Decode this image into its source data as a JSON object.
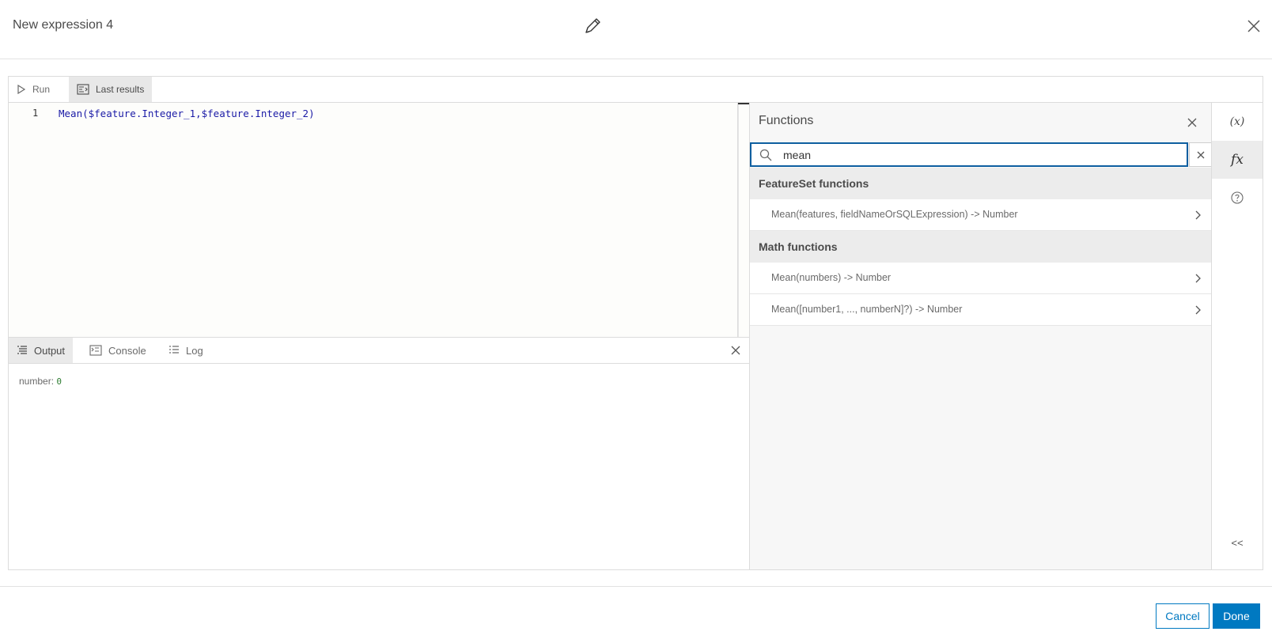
{
  "header": {
    "title": "New expression 4",
    "edit_icon": "pencil-icon",
    "close_icon": "close-icon"
  },
  "toolbar": {
    "run_label": "Run",
    "last_results_label": "Last results"
  },
  "editor": {
    "line_number": "1",
    "code": "Mean($feature.Integer_1,$feature.Integer_2)"
  },
  "output_tabs": {
    "output_label": "Output",
    "console_label": "Console",
    "log_label": "Log"
  },
  "output": {
    "key": "number:",
    "value": "0"
  },
  "functions_panel": {
    "title": "Functions",
    "search_value": "mean",
    "groups": [
      {
        "name": "FeatureSet functions",
        "items": [
          "Mean(features, fieldNameOrSQLExpression) -> Number"
        ]
      },
      {
        "name": "Math functions",
        "items": [
          "Mean(numbers) -> Number",
          "Mean([number1, ..., numberN]?) -> Number"
        ]
      }
    ]
  },
  "side_rail": {
    "variables_label": "(x)",
    "functions_label": "fx",
    "collapse_label": "<<"
  },
  "footer": {
    "cancel_label": "Cancel",
    "done_label": "Done"
  },
  "colors": {
    "accent": "#0079c1",
    "search_border": "#0e5fa0",
    "code_text": "#1a1aa6"
  }
}
